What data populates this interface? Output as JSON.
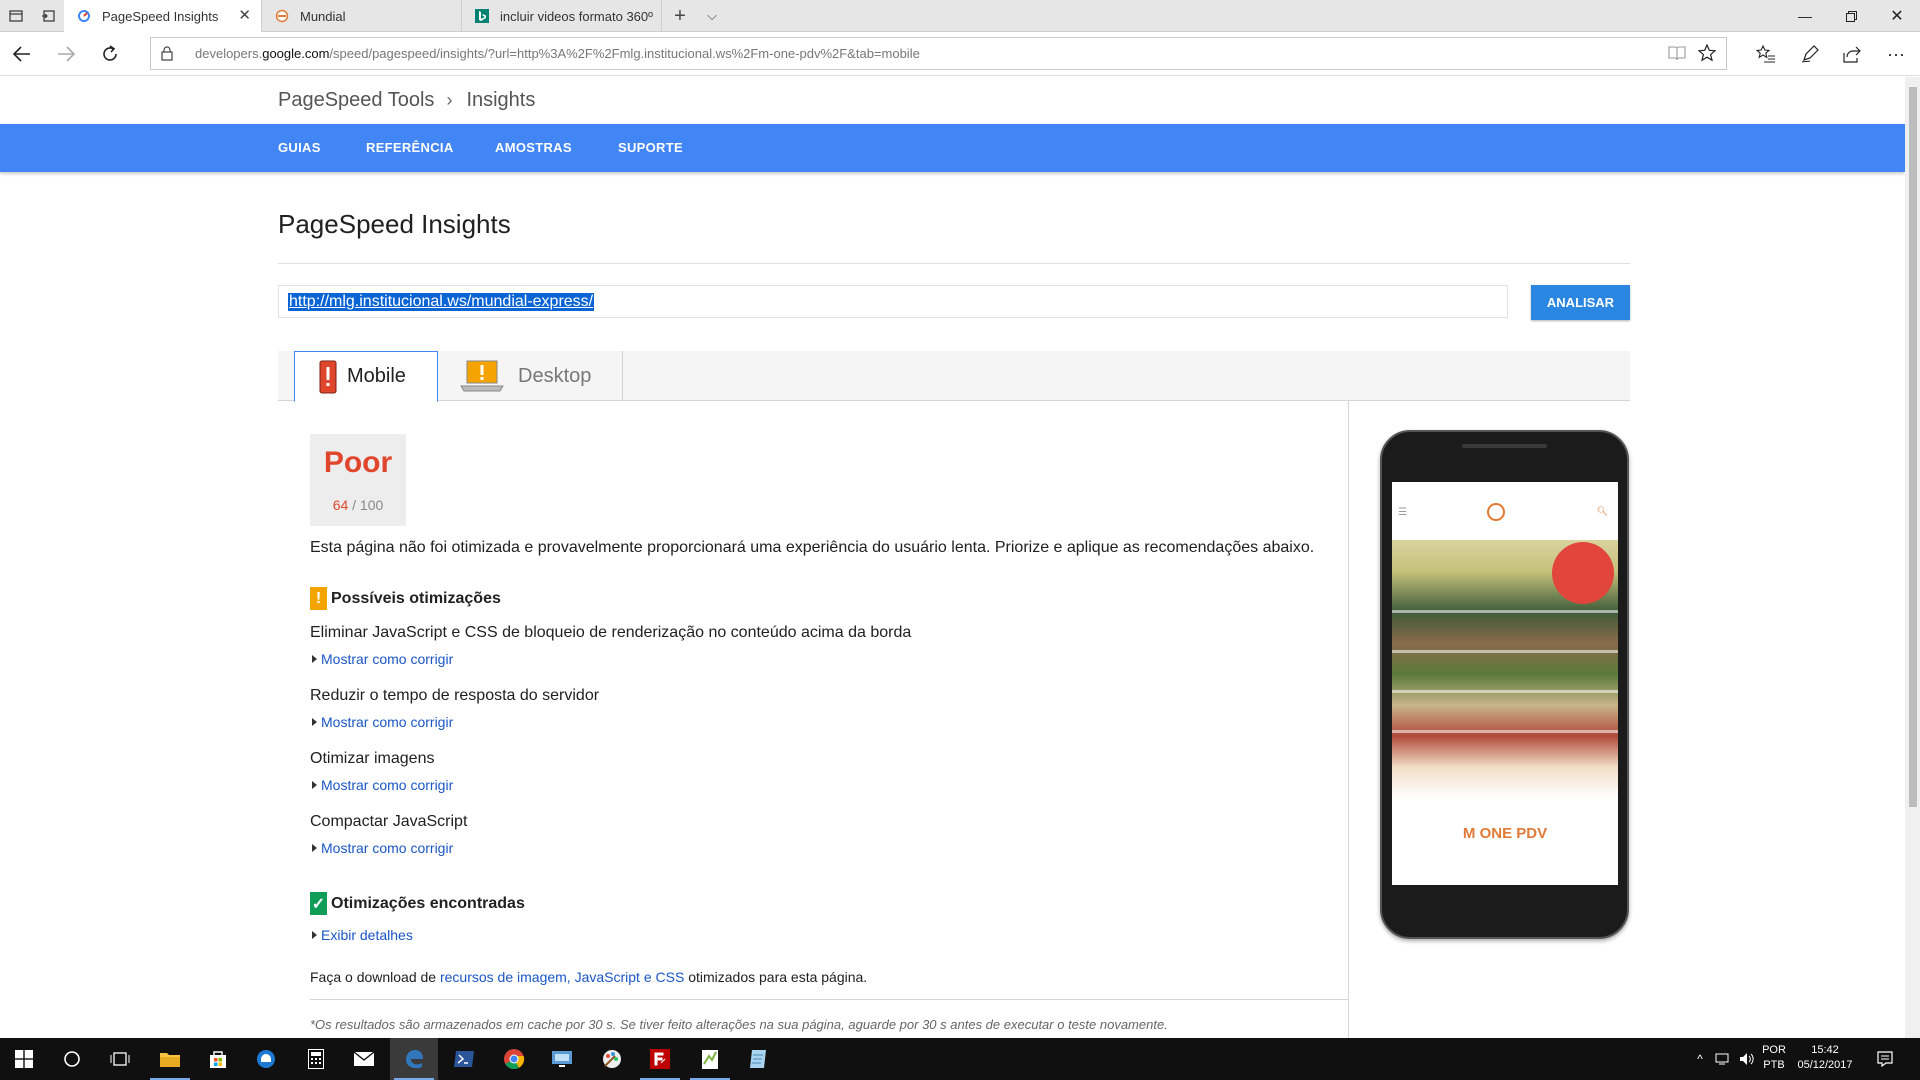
{
  "browser": {
    "tabs": [
      {
        "title": "PageSpeed Insights",
        "active": true
      },
      {
        "title": "Mundial",
        "active": false
      },
      {
        "title": "incluir videos formato 360º",
        "active": false
      }
    ],
    "url_prefix": "developers.",
    "url_domain": "google.com",
    "url_path": "/speed/pagespeed/insights/?url=http%3A%2F%2Fmlg.institucional.ws%2Fm-one-pdv%2F&tab=mobile"
  },
  "page": {
    "breadcrumb": {
      "parent": "PageSpeed Tools",
      "current": "Insights"
    },
    "nav": [
      "GUIAS",
      "REFERÊNCIA",
      "AMOSTRAS",
      "SUPORTE"
    ],
    "title": "PageSpeed Insights",
    "input_value": "http://mlg.institucional.ws/mundial-express/",
    "analyze_label": "ANALISAR",
    "device_tabs": {
      "mobile": "Mobile",
      "desktop": "Desktop"
    },
    "score": {
      "label": "Poor",
      "value": "64",
      "max": "/ 100"
    },
    "summary": "Esta página não foi otimizada e provavelmente proporcionará uma experiência do usuário lenta. Priorize e aplique as recomendações abaixo.",
    "possible": {
      "heading": "Possíveis otimizações",
      "items": [
        {
          "title": "Eliminar JavaScript e CSS de bloqueio de renderização no conteúdo acima da borda",
          "link": "Mostrar como corrigir"
        },
        {
          "title": "Reduzir o tempo de resposta do servidor",
          "link": "Mostrar como corrigir"
        },
        {
          "title": "Otimizar imagens",
          "link": "Mostrar como corrigir"
        },
        {
          "title": "Compactar JavaScript",
          "link": "Mostrar como corrigir"
        }
      ]
    },
    "found": {
      "heading": "Otimizações encontradas",
      "link": "Exibir detalhes"
    },
    "download": {
      "before": "Faça o download de ",
      "link": "recursos de imagem, JavaScript e CSS",
      "after": " otimizados para esta página."
    },
    "note": "*Os resultados são armazenados em cache por 30 s. Se tiver feito alterações na sua página, aguarde por 30 s antes de executar o teste novamente.",
    "preview_text": "M ONE PDV"
  },
  "taskbar": {
    "lang": [
      "POR",
      "PTB"
    ],
    "time": "15:42",
    "date": "05/12/2017"
  },
  "colors": {
    "accent": "#4285f4",
    "poor": "#e0462c",
    "warn": "#f4a400",
    "ok": "#0f9d58",
    "link": "#1a56c6"
  }
}
